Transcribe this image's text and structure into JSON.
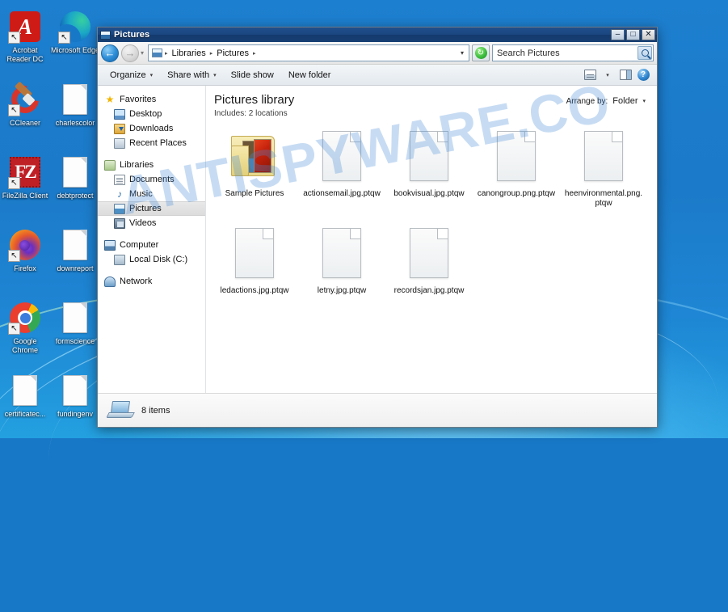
{
  "desktop": {
    "icons": [
      {
        "label": "Acrobat Reader DC",
        "icon": "acrobat-icon",
        "kind": "acrobat",
        "shortcut": true
      },
      {
        "label": "Microsoft Edge",
        "icon": "edge-icon",
        "kind": "edge",
        "shortcut": true
      },
      {
        "label": "CCleaner",
        "icon": "ccleaner-icon",
        "kind": "ccleaner",
        "shortcut": true
      },
      {
        "label": "charlescolor",
        "icon": "file-icon",
        "kind": "page",
        "shortcut": false
      },
      {
        "label": "FileZilla Client",
        "icon": "filezilla-icon",
        "kind": "filezilla",
        "shortcut": true
      },
      {
        "label": "debtprotect",
        "icon": "file-icon",
        "kind": "page",
        "shortcut": false
      },
      {
        "label": "Firefox",
        "icon": "firefox-icon",
        "kind": "firefox",
        "shortcut": true
      },
      {
        "label": "downreport",
        "icon": "file-icon",
        "kind": "page",
        "shortcut": false
      },
      {
        "label": "Google Chrome",
        "icon": "chrome-icon",
        "kind": "chrome",
        "shortcut": true
      },
      {
        "label": "formscience",
        "icon": "file-icon",
        "kind": "page",
        "shortcut": false
      },
      {
        "label": "certificatec...",
        "icon": "file-icon",
        "kind": "page",
        "shortcut": false
      },
      {
        "label": "fundingenv",
        "icon": "file-icon",
        "kind": "page",
        "shortcut": false
      }
    ]
  },
  "window": {
    "title": "Pictures",
    "title_icon": "pictures-library-icon",
    "buttons": {
      "minimize": "–",
      "maximize": "□",
      "close": "✕"
    },
    "nav": {
      "back_label": "←",
      "forward_label": "→",
      "history_caret": "▾",
      "refresh_glyph": "↻"
    },
    "address": {
      "crumbs": [
        "Libraries",
        "Pictures"
      ],
      "separator": "▸",
      "dropdown_caret": "▾"
    },
    "search": {
      "placeholder": "Search Pictures",
      "value": "",
      "icon": "search-icon"
    },
    "toolbar": {
      "items": [
        {
          "label": "Organize",
          "caret": "▾"
        },
        {
          "label": "Share with",
          "caret": "▾"
        },
        {
          "label": "Slide show",
          "caret": ""
        },
        {
          "label": "New folder",
          "caret": ""
        }
      ],
      "view_caret": "▾",
      "icons": {
        "change_view": "change-view-icon",
        "preview_pane": "preview-pane-icon",
        "help": "help-icon",
        "help_glyph": "?"
      }
    }
  },
  "sidebar": {
    "groups": [
      {
        "header": {
          "label": "Favorites",
          "icon": "favorites-star-icon"
        },
        "items": [
          {
            "label": "Desktop",
            "icon": "desktop-icon",
            "selected": false
          },
          {
            "label": "Downloads",
            "icon": "downloads-icon",
            "selected": false
          },
          {
            "label": "Recent Places",
            "icon": "recent-places-icon",
            "selected": false
          }
        ]
      },
      {
        "header": {
          "label": "Libraries",
          "icon": "libraries-icon"
        },
        "items": [
          {
            "label": "Documents",
            "icon": "documents-icon",
            "selected": false
          },
          {
            "label": "Music",
            "icon": "music-icon",
            "selected": false
          },
          {
            "label": "Pictures",
            "icon": "pictures-icon",
            "selected": true
          },
          {
            "label": "Videos",
            "icon": "videos-icon",
            "selected": false
          }
        ]
      },
      {
        "header": {
          "label": "Computer",
          "icon": "computer-icon"
        },
        "items": [
          {
            "label": "Local Disk (C:)",
            "icon": "local-disk-icon",
            "selected": false
          }
        ]
      },
      {
        "header": {
          "label": "Network",
          "icon": "network-icon"
        },
        "items": []
      }
    ]
  },
  "library": {
    "title": "Pictures library",
    "subtitle": "Includes:  2 locations",
    "arrange_label": "Arrange by:",
    "arrange_value": "Folder",
    "arrange_caret": "▾"
  },
  "files": [
    {
      "name": "Sample Pictures",
      "type": "folder"
    },
    {
      "name": "actionsemail.jpg.ptqw",
      "type": "file"
    },
    {
      "name": "bookvisual.jpg.ptqw",
      "type": "file"
    },
    {
      "name": "canongroup.png.ptqw",
      "type": "file"
    },
    {
      "name": "heenvironmental.png.ptqw",
      "type": "file"
    },
    {
      "name": "ledactions.jpg.ptqw",
      "type": "file"
    },
    {
      "name": "letny.jpg.ptqw",
      "type": "file"
    },
    {
      "name": "recordsjan.jpg.ptqw",
      "type": "file"
    }
  ],
  "statusbar": {
    "icon": "computer-icon",
    "text": "8 items"
  },
  "watermark": {
    "text": "ANTISPYWARE.CO"
  },
  "colors": {
    "desktop_blue": "#1878c8",
    "titlebar_blue": "#1b4781",
    "selection_gray": "#e0e0e0",
    "watermark_blue": "#468cd7"
  }
}
